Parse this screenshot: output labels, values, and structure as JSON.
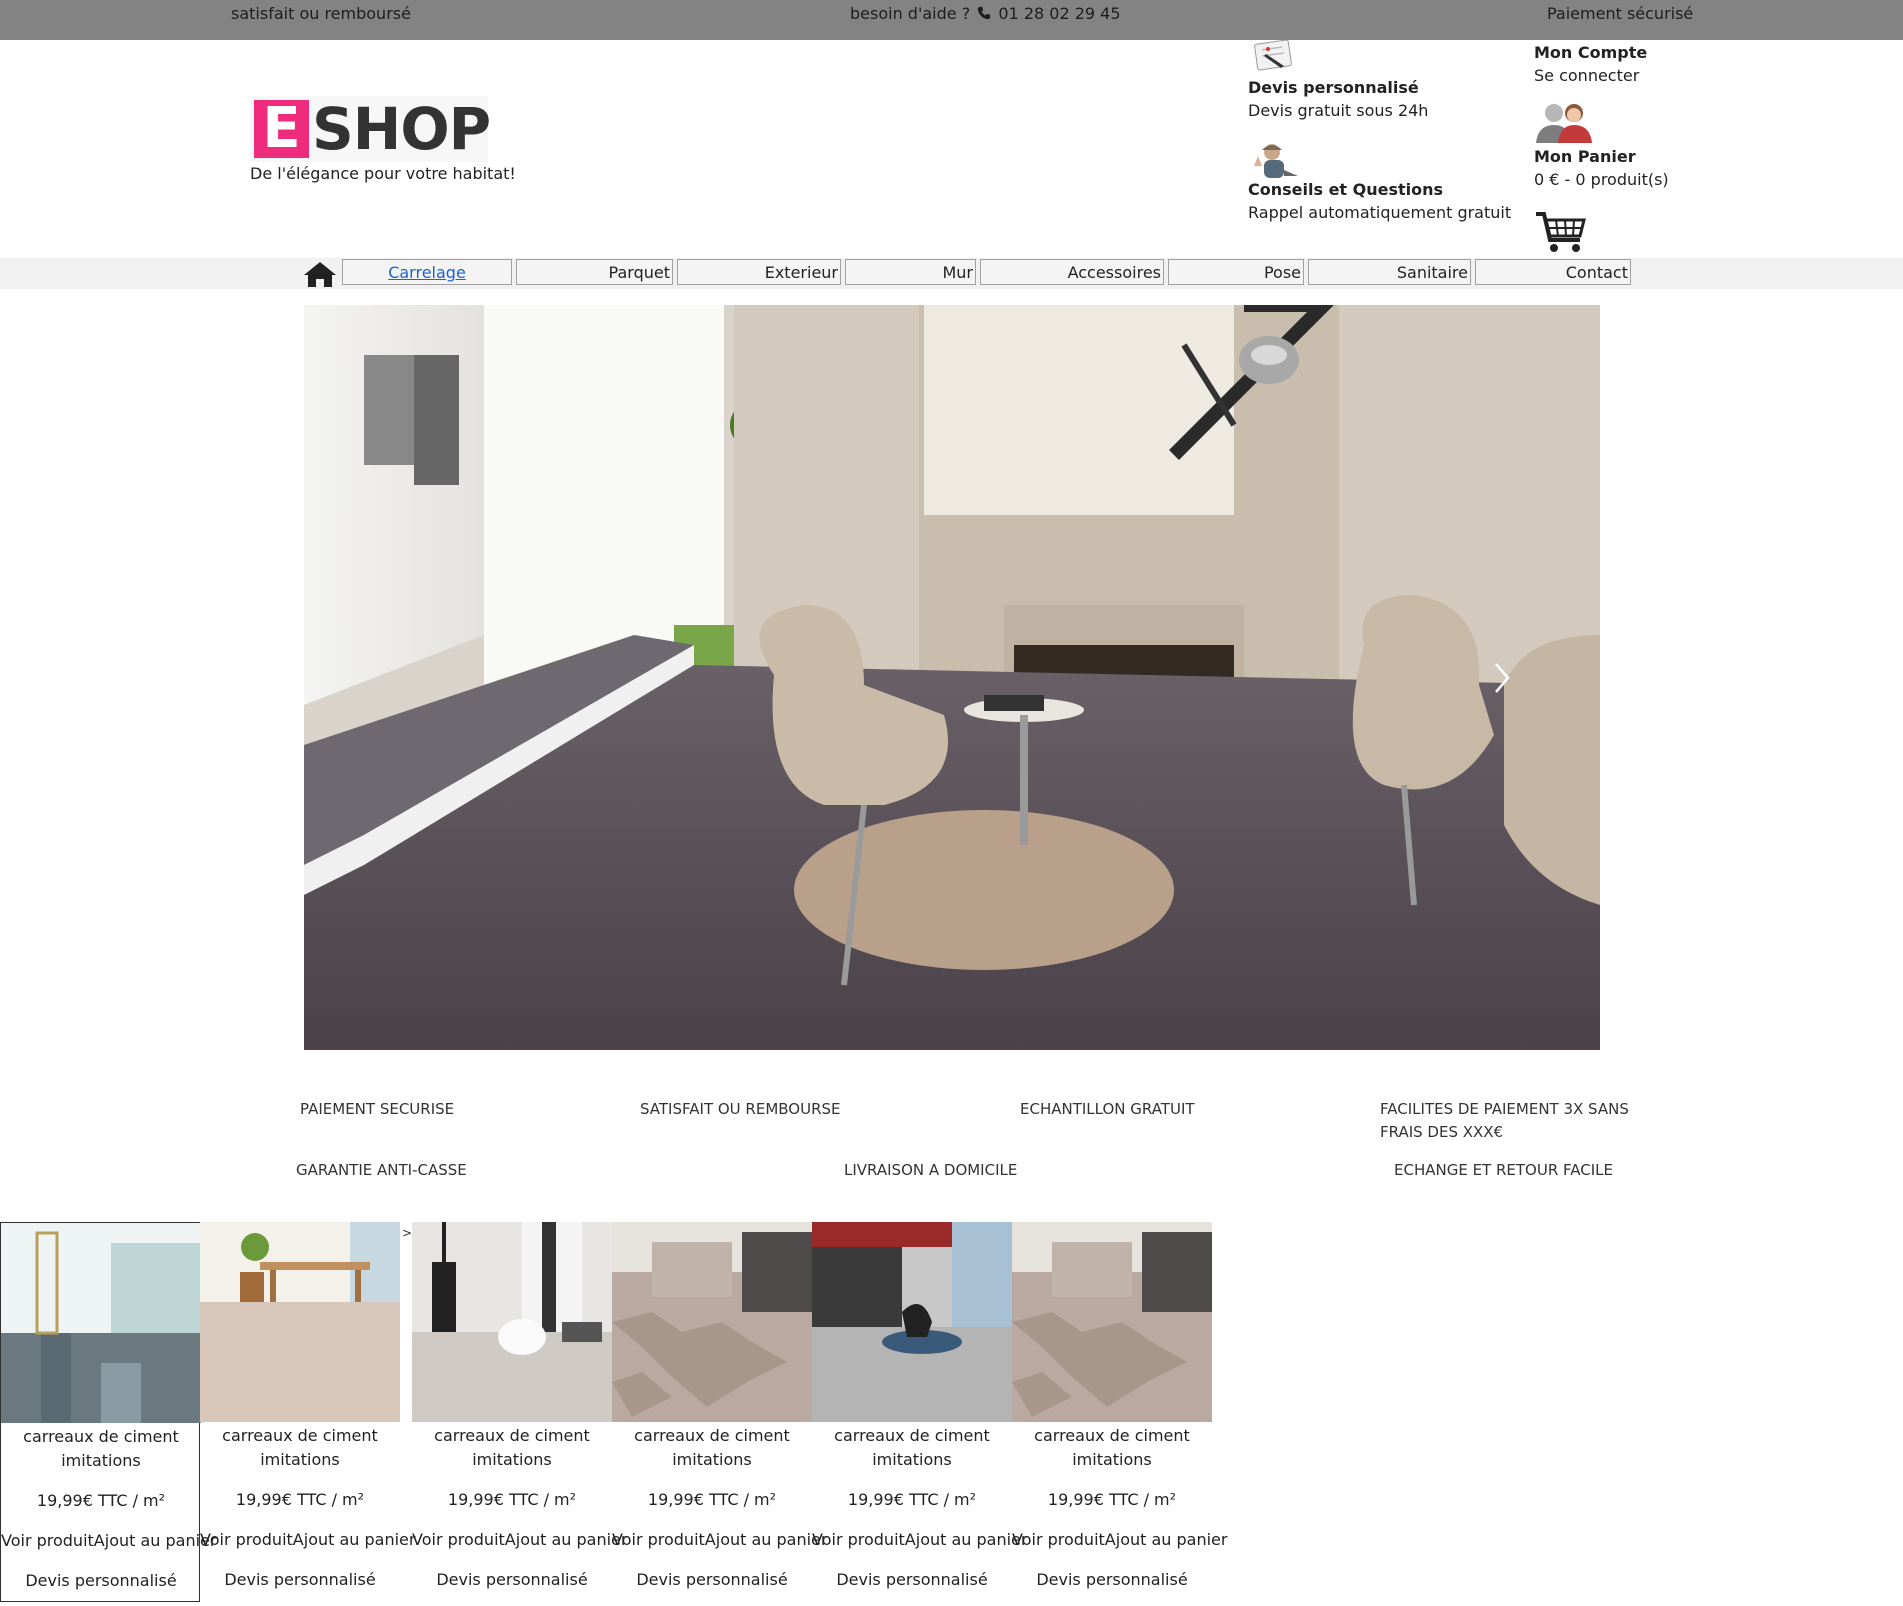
{
  "topbar": {
    "left": "satisfait ou remboursé",
    "help_label": "besoin d'aide ?",
    "phone": "01 28 02 29 45",
    "right": "Paiement sécurisé"
  },
  "brand": {
    "logo_letter": "E",
    "logo_rest": "SHOP",
    "tagline": "De l'élégance pour votre habitat!",
    "accent_color": "#ee2b7d"
  },
  "services": {
    "quote_title": "Devis personnalisé",
    "quote_sub": "Devis gratuit sous 24h",
    "advice_title": "Conseils et Questions",
    "advice_sub": "Rappel automatiquement gratuit",
    "account_title": "Mon Compte",
    "account_sub": "Se connecter",
    "cart_title": "Mon Panier",
    "cart_sub": "0 € - 0 produit(s)"
  },
  "nav": [
    "Carrelage",
    "Parquet",
    "Exterieur",
    "Mur",
    "Accessoires",
    "Pose",
    "Sanitaire",
    "Contact"
  ],
  "features": {
    "f1": "PAIEMENT SECURISE",
    "f2": "SATISFAIT OU REMBOURSE",
    "f3": "ECHANTILLON GRATUIT",
    "f4_line1": "FACILITES DE PAIEMENT 3X SANS",
    "f4_line2": "FRAIS DES XXX€",
    "f5": "GARANTIE ANTI-CASSE",
    "f6": "LIVRAISON A DOMICILE",
    "f7": "ECHANGE ET RETOUR FACILE"
  },
  "products": [
    {
      "name_line1": "carreaux de ciment",
      "name_line2": "imitations",
      "price": "19,99€ TTC / m²",
      "view": "Voir produit",
      "add": "Ajout au panier",
      "quote": "Devis personnalisé"
    },
    {
      "name_line1": "carreaux de ciment",
      "name_line2": "imitations",
      "price": "19,99€ TTC / m²",
      "view": "Voir produit",
      "add": "Ajout au panier",
      "quote": "Devis personnalisé"
    },
    {
      "name_line1": "carreaux de ciment",
      "name_line2": "imitations",
      "price": "19,99€ TTC / m²",
      "view": "Voir produit",
      "add": "Ajout au panier",
      "quote": "Devis personnalisé"
    },
    {
      "name_line1": "carreaux de ciment",
      "name_line2": "imitations",
      "price": "19,99€ TTC / m²",
      "view": "Voir produit",
      "add": "Ajout au panier",
      "quote": "Devis personnalisé"
    },
    {
      "name_line1": "carreaux de ciment",
      "name_line2": "imitations",
      "price": "19,99€ TTC / m²",
      "view": "Voir produit",
      "add": "Ajout au panier",
      "quote": "Devis personnalisé"
    },
    {
      "name_line1": "carreaux de ciment",
      "name_line2": "imitations",
      "price": "19,99€ TTC / m²",
      "view": "Voir produit",
      "add": "Ajout au panier",
      "quote": "Devis personnalisé"
    }
  ],
  "carousel_next_label": ">"
}
